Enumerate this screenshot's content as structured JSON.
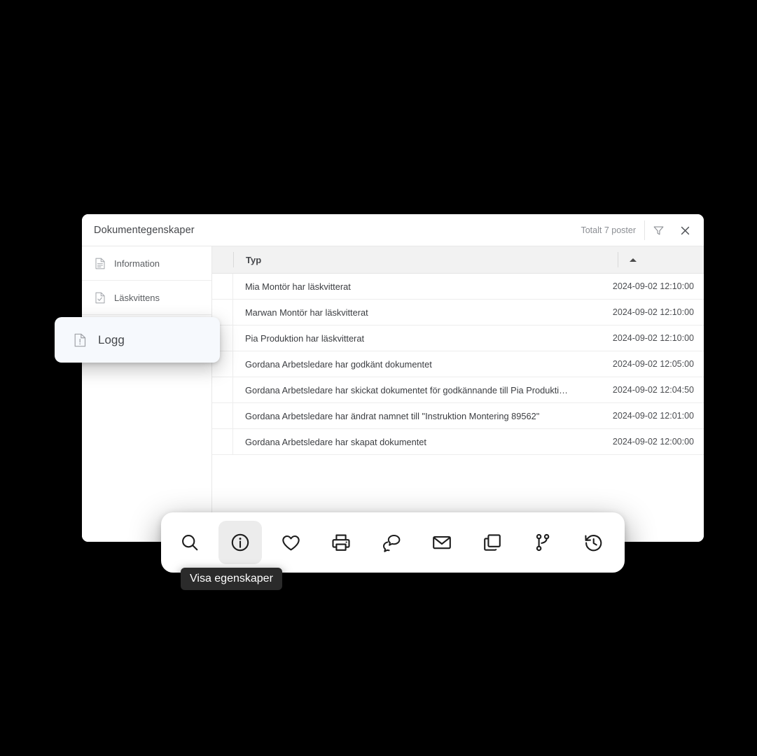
{
  "dialog": {
    "title": "Dokumentegenskaper",
    "total_label": "Totalt 7 poster",
    "filter_icon": "filter-funnel-icon",
    "close_icon": "close-icon"
  },
  "sidebar": {
    "items": [
      {
        "label": "Information",
        "icon": "document-lines-icon",
        "active": false
      },
      {
        "label": "Läskvittens",
        "icon": "document-check-icon",
        "active": false
      }
    ],
    "floating_item": {
      "label": "Logg",
      "icon": "document-alert-icon",
      "active": true
    }
  },
  "table": {
    "columns": [
      {
        "label": "Typ",
        "sort": "asc"
      },
      {
        "label": "",
        "sort": "asc"
      }
    ],
    "sort_icon": "sort-ascending-caret-icon",
    "rows": [
      {
        "typ": "Mia Montör har läskvitterat",
        "datum": "2024-09-02 12:10:00"
      },
      {
        "typ": "Marwan Montör har läskvitterat",
        "datum": "2024-09-02 12:10:00"
      },
      {
        "typ": "Pia Produktion har läskvitterat",
        "datum": "2024-09-02 12:10:00"
      },
      {
        "typ": "Gordana Arbetsledare har godkänt dokumentet",
        "datum": "2024-09-02 12:05:00"
      },
      {
        "typ": "Gordana Arbetsledare har skickat dokumentet för godkännande till Pia Produktion",
        "datum": "2024-09-02 12:04:50"
      },
      {
        "typ": "Gordana Arbetsledare har ändrat namnet till \"Instruktion Montering 89562\"",
        "datum": "2024-09-02 12:01:00"
      },
      {
        "typ": "Gordana Arbetsledare har skapat dokumentet",
        "datum": "2024-09-02 12:00:00"
      }
    ]
  },
  "toolbar": {
    "buttons": [
      {
        "name": "search-icon",
        "active": false
      },
      {
        "name": "info-circle-icon",
        "active": true
      },
      {
        "name": "heart-icon",
        "active": false
      },
      {
        "name": "printer-icon",
        "active": false
      },
      {
        "name": "chat-bubbles-icon",
        "active": false
      },
      {
        "name": "mail-envelope-icon",
        "active": false
      },
      {
        "name": "copy-duplicate-icon",
        "active": false
      },
      {
        "name": "git-branch-icon",
        "active": false
      },
      {
        "name": "history-clock-icon",
        "active": false
      }
    ]
  },
  "tooltip": {
    "text": "Visa egenskaper"
  },
  "colors": {
    "page_background": "#000000",
    "dialog_background": "#ffffff",
    "table_header": "#f2f2f2",
    "active_item": "#f6f9fd",
    "toolbar_active": "#ececec",
    "tooltip_background": "#2b2b2b",
    "text_primary": "#3b3d41",
    "text_muted": "#8b8e93"
  }
}
